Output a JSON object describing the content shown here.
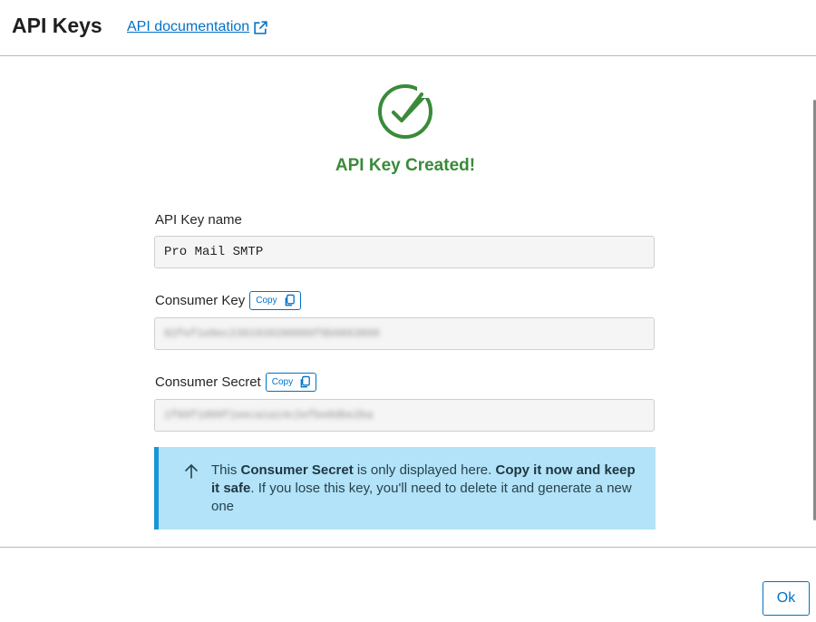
{
  "header": {
    "title": "API Keys",
    "doc_link": "API documentation"
  },
  "status": {
    "message": "API Key Created!",
    "color": "#3a8a3a"
  },
  "fields": {
    "name": {
      "label": "API Key name",
      "value": "Pro Mail SMTP"
    },
    "consumer_key": {
      "label": "Consumer Key",
      "copy_label": "Copy",
      "value_masked": "82fef1e0ec2391939280009f8b0863899"
    },
    "consumer_secret": {
      "label": "Consumer Secret",
      "copy_label": "Copy",
      "value_masked": "1f60f1009f1eeca1a14c2efbe0dbe2ba"
    }
  },
  "notice": {
    "part1": "This ",
    "part2": "Consumer Secret",
    "part3": " is only displayed here. ",
    "part4": "Copy it now and keep it safe",
    "part5": ". If you lose this key, you'll need to delete it and generate a new one"
  },
  "footer": {
    "ok_label": "Ok"
  },
  "colors": {
    "accent": "#0072c6",
    "success": "#3a8a3a",
    "notice_bg": "#b2e3f8",
    "notice_border": "#1a95d8"
  },
  "icons": [
    "external-link-icon",
    "check-circle-icon",
    "copy-icon",
    "arrow-up-icon"
  ]
}
